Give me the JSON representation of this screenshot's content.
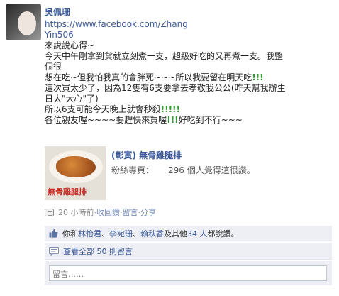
{
  "post": {
    "author": "吳佩珊",
    "link_part1": "https://www.facebook.com/Zhang",
    "link_part2": "Yin506",
    "lines": [
      "來說說心得~",
      "今天中午剛拿到貨就立刻煮一支，超級好吃的又再煮一支。我整",
      "個很",
      "想在吃~但我怕我真的會胖死~~~所以我要留在明天吃",
      "這次買太少了，因為12隻有6支要拿去孝敬我公公(昨天幫我辦生",
      "日太\"大心\"了)",
      "所以6支可能今天晚上就會秒殺",
      "各位親友喔~~~~要趕快來買喔",
      "好吃到不行~~~"
    ],
    "bang3": "!!!",
    "bang5": "!!!!!",
    "bang3b": "!!!"
  },
  "share": {
    "title": "(彰寅) 無骨雞腿排",
    "fans_label": "粉絲專頁：",
    "fans_count": "296 個人覺得這很讚。",
    "thumb_text": "無骨雞腿排"
  },
  "meta": {
    "time": "20 小時前",
    "dot": " · ",
    "unlike": "收回讚",
    "comment": "留言",
    "share": "分享"
  },
  "likes": {
    "prefix": "你和",
    "name1": "林怡君",
    "comma1": "、",
    "name2": "李宛珊",
    "comma2": "、",
    "name3": "賴秋香",
    "and": "及其他",
    "others": " 34 人",
    "suffix": "都說讚。"
  },
  "comments": {
    "view_all": "查看全部 50 則留言"
  },
  "compose": {
    "placeholder": "留言……"
  },
  "colors": {
    "link": "#3b5998",
    "accent_green": "#2f9e2f",
    "panel_bg": "#edeff4"
  },
  "icons": {
    "meta": "share-source-icon",
    "likes": "thumbs-up-icon",
    "comments": "comment-bubble-icon"
  }
}
